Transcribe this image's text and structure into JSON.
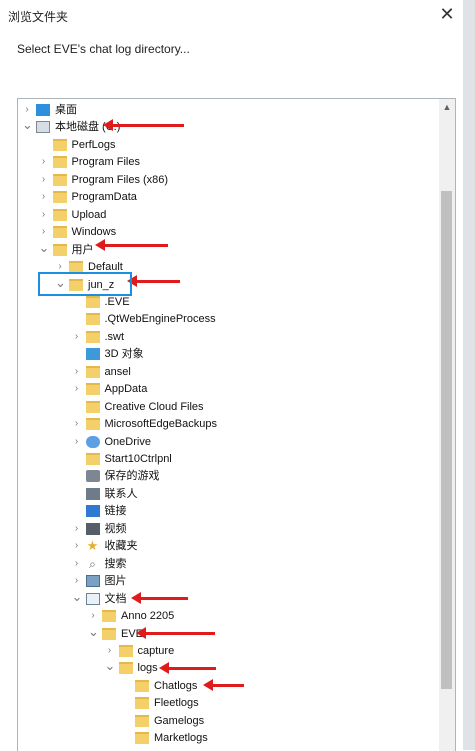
{
  "window": {
    "title": "浏览文件夹",
    "close_glyph": "✕"
  },
  "prompt": "Select EVE's chat log directory...",
  "tree": [
    {
      "label": "桌面",
      "icon": "desktop-icon",
      "arrow": "collapsed"
    },
    {
      "label": "本地磁盘 (C:)",
      "icon": "drive-icon",
      "arrow": "expanded"
    },
    {
      "label": "PerfLogs",
      "icon": "folder-icon",
      "arrow": "none"
    },
    {
      "label": "Program Files",
      "icon": "folder-icon",
      "arrow": "collapsed"
    },
    {
      "label": "Program Files (x86)",
      "icon": "folder-icon",
      "arrow": "collapsed"
    },
    {
      "label": "ProgramData",
      "icon": "folder-icon",
      "arrow": "collapsed"
    },
    {
      "label": "Upload",
      "icon": "folder-icon",
      "arrow": "collapsed"
    },
    {
      "label": "Windows",
      "icon": "folder-icon",
      "arrow": "collapsed"
    },
    {
      "label": "用户",
      "icon": "folder-icon",
      "arrow": "expanded"
    },
    {
      "label": "Default",
      "icon": "folder-icon",
      "arrow": "collapsed"
    },
    {
      "label": "jun_z",
      "icon": "folder-icon",
      "arrow": "expanded"
    },
    {
      "label": ".EVE",
      "icon": "folder-icon",
      "arrow": "none"
    },
    {
      "label": ".QtWebEngineProcess",
      "icon": "folder-icon",
      "arrow": "none"
    },
    {
      "label": ".swt",
      "icon": "folder-icon",
      "arrow": "collapsed"
    },
    {
      "label": "3D 对象",
      "icon": "cube-icon",
      "arrow": "none"
    },
    {
      "label": "ansel",
      "icon": "folder-icon",
      "arrow": "collapsed"
    },
    {
      "label": "AppData",
      "icon": "folder-icon",
      "arrow": "collapsed"
    },
    {
      "label": "Creative Cloud Files",
      "icon": "folder-icon",
      "arrow": "none"
    },
    {
      "label": "MicrosoftEdgeBackups",
      "icon": "folder-icon",
      "arrow": "collapsed"
    },
    {
      "label": "OneDrive",
      "icon": "cloud-icon",
      "arrow": "collapsed"
    },
    {
      "label": "Start10Ctrlpnl",
      "icon": "folder-icon",
      "arrow": "none"
    },
    {
      "label": "保存的游戏",
      "icon": "game-icon",
      "arrow": "none"
    },
    {
      "label": "联系人",
      "icon": "contacts-icon",
      "arrow": "none"
    },
    {
      "label": "链接",
      "icon": "link-icon",
      "arrow": "none"
    },
    {
      "label": "视频",
      "icon": "video-icon",
      "arrow": "collapsed"
    },
    {
      "label": "收藏夹",
      "icon": "star-icon",
      "arrow": "collapsed"
    },
    {
      "label": "搜索",
      "icon": "search-icon",
      "arrow": "collapsed"
    },
    {
      "label": "图片",
      "icon": "picture-icon",
      "arrow": "collapsed"
    },
    {
      "label": "文档",
      "icon": "document-icon",
      "arrow": "expanded"
    },
    {
      "label": "Anno 2205",
      "icon": "folder-icon",
      "arrow": "collapsed"
    },
    {
      "label": "EVE",
      "icon": "folder-icon",
      "arrow": "expanded"
    },
    {
      "label": "capture",
      "icon": "folder-icon",
      "arrow": "collapsed"
    },
    {
      "label": "logs",
      "icon": "folder-icon",
      "arrow": "expanded"
    },
    {
      "label": "Chatlogs",
      "icon": "folder-icon",
      "arrow": "none"
    },
    {
      "label": "Fleetlogs",
      "icon": "folder-icon",
      "arrow": "none"
    },
    {
      "label": "Gamelogs",
      "icon": "folder-icon",
      "arrow": "none"
    },
    {
      "label": "Marketlogs",
      "icon": "folder-icon",
      "arrow": "none"
    }
  ],
  "colors": {
    "annotation_arrow": "#e01b1b",
    "selection_border": "#1c8fe0"
  }
}
